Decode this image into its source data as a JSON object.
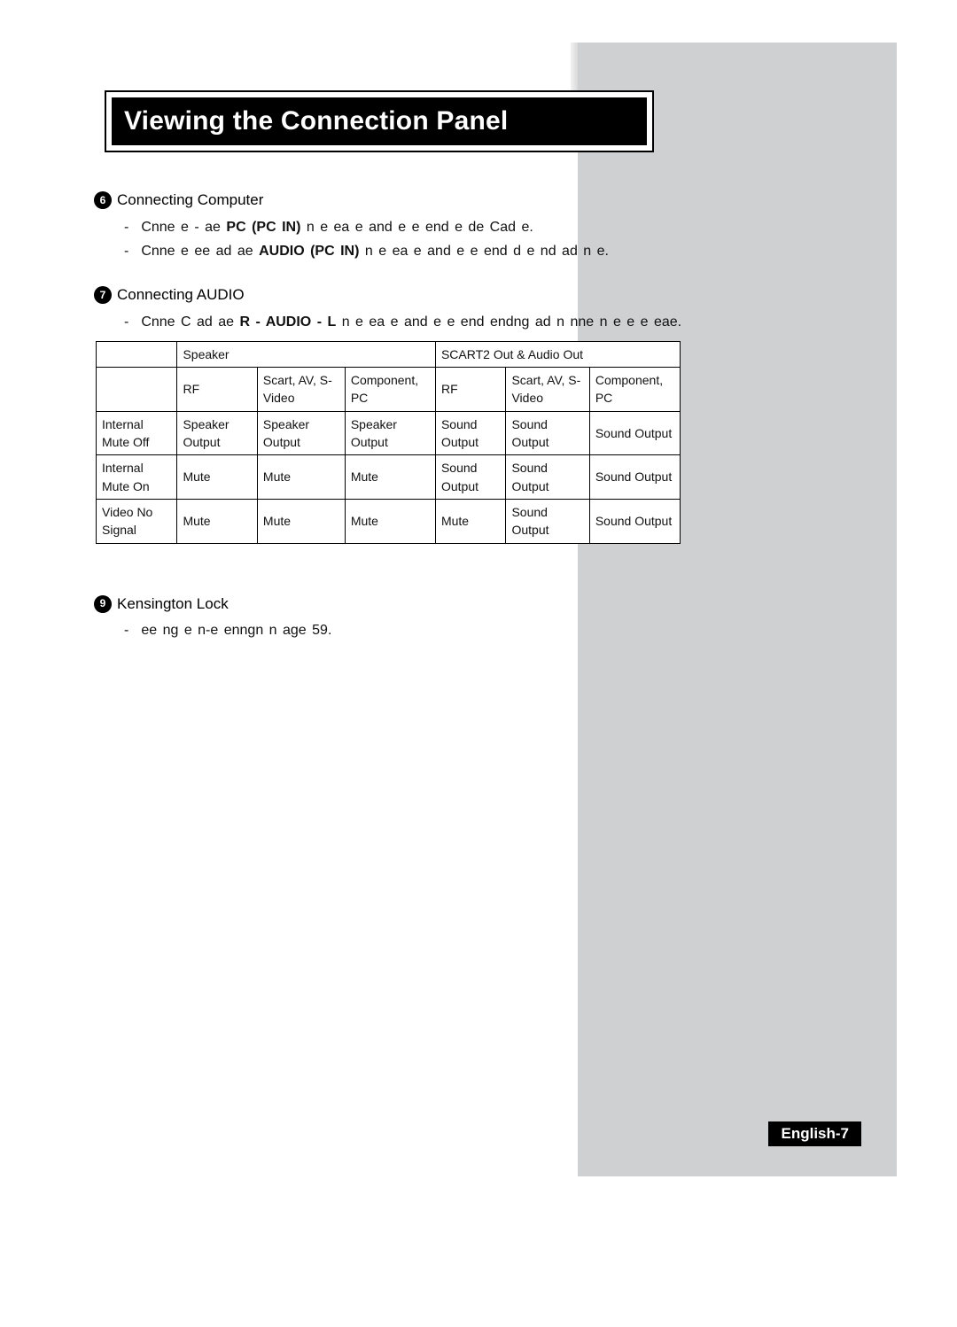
{
  "page_title": "Viewing the Connection Panel",
  "page_number_label": "English-7",
  "sections": {
    "s6": {
      "num": "6",
      "head": "Connecting Computer",
      "items": [
        {
          "pre": "Cnne e - ae ",
          "bold": "PC (PC IN)",
          "post": " n e ea  e and e e end  e de Cad e."
        },
        {
          "pre": "Cnne e ee ad ae ",
          "bold": "AUDIO (PC IN)",
          "post": " n e ea  e and e e end d  e nd ad n  e."
        }
      ]
    },
    "s7": {
      "num": "7",
      "head": "Connecting AUDIO",
      "items": [
        {
          "pre": "Cnne C ad ae ",
          "bold": "R - AUDIO - L",
          "post": " n e ea  e and e e end  endng ad n nne n e e  e eae."
        }
      ]
    },
    "s9": {
      "num": "9",
      "head": "Kensington Lock",
      "items": [
        {
          "pre": "ee  ng e n-e enngn  n age 59.",
          "bold": "",
          "post": ""
        }
      ]
    }
  },
  "chart_data": {
    "type": "table",
    "col_group1": "Speaker",
    "col_group2": "SCART2 Out & Audio Out",
    "sub_cols": [
      "RF",
      "Scart, AV, S-Video",
      "Component, PC",
      "RF",
      "Scart, AV, S-Video",
      "Component, PC"
    ],
    "rows": [
      {
        "label": "Internal Mute Off",
        "cells": [
          "Speaker Output",
          "Speaker Output",
          "Speaker Output",
          "Sound Output",
          "Sound Output",
          "Sound Output"
        ]
      },
      {
        "label": "Internal Mute On",
        "cells": [
          "Mute",
          "Mute",
          "Mute",
          "Sound Output",
          "Sound Output",
          "Sound Output"
        ]
      },
      {
        "label": "Video No Signal",
        "cells": [
          "Mute",
          "Mute",
          "Mute",
          "Mute",
          "Sound Output",
          "Sound Output"
        ]
      }
    ]
  }
}
